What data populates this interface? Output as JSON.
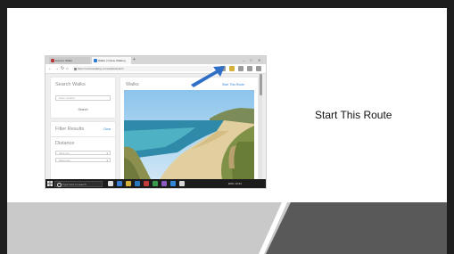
{
  "slide": {
    "caption": "Start This Route"
  },
  "browser": {
    "tabs": [
      {
        "label": "Explore Walks"
      },
      {
        "label": "Walks | Online Walking"
      }
    ],
    "new_tab": "+",
    "window_controls": {
      "minimize": "–",
      "maximize": "□",
      "close": "✕"
    },
    "nav": {
      "back": "←",
      "forward": "→",
      "reload": "↻",
      "home": "⌂"
    },
    "url": "https://onlinewalking.com/walks/search"
  },
  "website": {
    "search_panel": {
      "title": "Search Walks",
      "input_placeholder": "Enter location",
      "button": "Search"
    },
    "filter_panel": {
      "title": "Filter Results",
      "clear_label": "Clear",
      "distance_label": "Distance",
      "select1": "Minimum",
      "select2": "Maximum"
    },
    "walks_panel": {
      "title": "Walks",
      "start_link": "Start This Route"
    }
  },
  "taskbar": {
    "search_placeholder": "Type here to search",
    "tray_text": "ENG  10:24"
  },
  "colors": {
    "accent_blue": "#3a86d8",
    "arrow_blue": "#2f6fc6",
    "footer_light": "#c9c9c9",
    "footer_dark": "#595959"
  }
}
